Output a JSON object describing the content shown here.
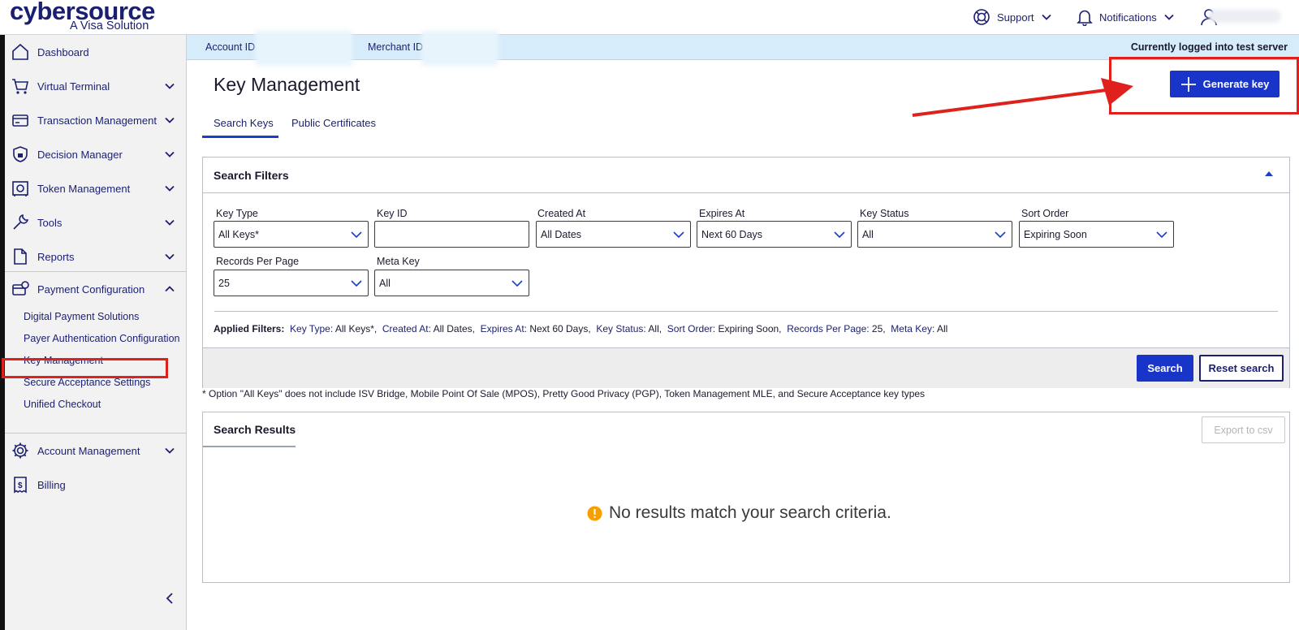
{
  "brand": {
    "logo_text": "cybersource",
    "tagline": "A Visa Solution"
  },
  "topnav": {
    "support_label": "Support",
    "notifications_label": "Notifications"
  },
  "sidebar": {
    "items": [
      {
        "label": "Dashboard"
      },
      {
        "label": "Virtual Terminal"
      },
      {
        "label": "Transaction Management"
      },
      {
        "label": "Decision Manager"
      },
      {
        "label": "Token Management"
      },
      {
        "label": "Tools"
      },
      {
        "label": "Reports"
      },
      {
        "label": "Payment Configuration"
      },
      {
        "label": "Account Management"
      },
      {
        "label": "Billing"
      }
    ],
    "payment_config_subitems": [
      {
        "label": "Digital Payment Solutions"
      },
      {
        "label": "Payer Authentication Configuration"
      },
      {
        "label": "Key Management"
      },
      {
        "label": "Secure Acceptance Settings"
      },
      {
        "label": "Unified Checkout"
      }
    ]
  },
  "account_bar": {
    "account_id_label": "Account ID",
    "merchant_id_label": "Merchant ID",
    "server_notice": "Currently logged into test server"
  },
  "page": {
    "title": "Key Management",
    "tabs": [
      {
        "label": "Search Keys"
      },
      {
        "label": "Public Certificates"
      }
    ],
    "generate_key_label": "Generate key"
  },
  "filters": {
    "title": "Search Filters",
    "key_type": {
      "label": "Key Type",
      "value": "All Keys*"
    },
    "key_id": {
      "label": "Key ID",
      "value": ""
    },
    "created_at": {
      "label": "Created At",
      "value": "All Dates"
    },
    "expires_at": {
      "label": "Expires At",
      "value": "Next 60 Days"
    },
    "key_status": {
      "label": "Key Status",
      "value": "All"
    },
    "sort_order": {
      "label": "Sort Order",
      "value": "Expiring Soon"
    },
    "records_per_page": {
      "label": "Records Per Page",
      "value": "25"
    },
    "meta_key": {
      "label": "Meta Key",
      "value": "All"
    },
    "applied_label": "Applied Filters:",
    "applied": [
      {
        "key": "Key Type:",
        "value": "All Keys*,"
      },
      {
        "key": "Created At:",
        "value": "All Dates,"
      },
      {
        "key": "Expires At:",
        "value": "Next 60 Days,"
      },
      {
        "key": "Key Status:",
        "value": "All,"
      },
      {
        "key": "Sort Order:",
        "value": "Expiring Soon,"
      },
      {
        "key": "Records Per Page:",
        "value": "25,"
      },
      {
        "key": "Meta Key:",
        "value": "All"
      }
    ],
    "search_label": "Search",
    "reset_label": "Reset search"
  },
  "footnote": "* Option \"All Keys\" does not include ISV Bridge, Mobile Point Of Sale (MPOS), Pretty Good Privacy (PGP), Token Management MLE, and Secure Acceptance key types",
  "results": {
    "title": "Search Results",
    "export_label": "Export to csv",
    "empty_message": "No results match your search criteria."
  },
  "colors": {
    "primary": "#1934c8",
    "brand": "#1a1f71",
    "annotation": "#e0201c",
    "account_bar": "#d6ecfa",
    "warning": "#f5a000"
  },
  "icons": [
    "support-icon",
    "bell-icon",
    "user-icon",
    "home-icon",
    "cart-icon",
    "card-icon",
    "shield-icon",
    "vault-icon",
    "wrench-icon",
    "document-icon",
    "payment-config-icon",
    "gear-icon",
    "receipt-icon",
    "chevron-down-icon",
    "chevron-up-icon",
    "collapse-left-icon",
    "plus-icon",
    "warning-icon"
  ]
}
